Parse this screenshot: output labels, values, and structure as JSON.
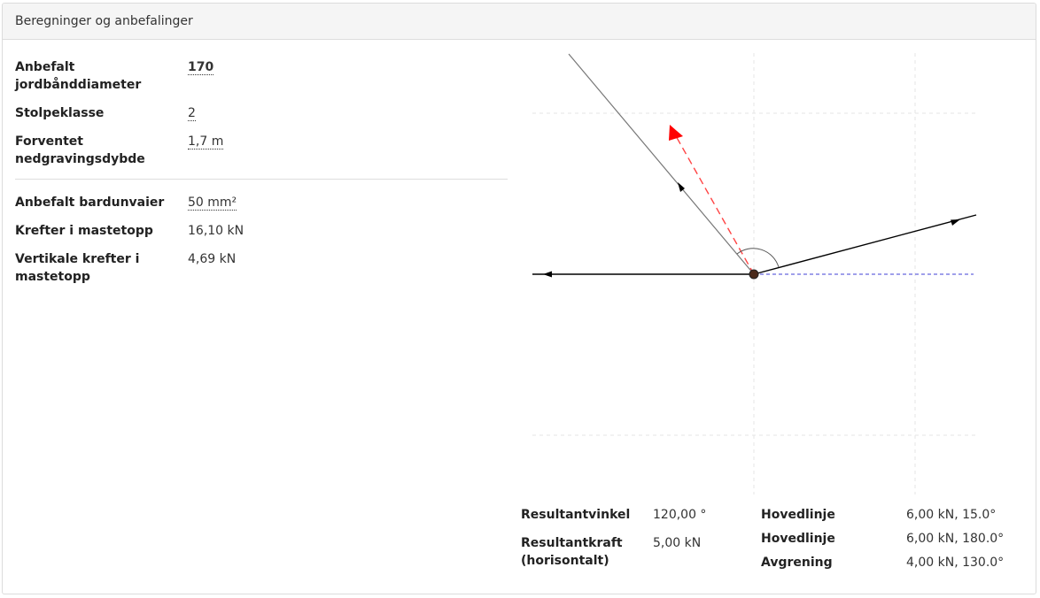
{
  "header": {
    "title": "Beregninger og anbefalinger"
  },
  "calc": {
    "jord_label": "Anbefalt jordbånddiameter",
    "jord_value": "170",
    "stolpe_label": "Stolpeklasse",
    "stolpe_value": "2",
    "dybde_label": "Forventet nedgravingsdybde",
    "dybde_value": "1,7 m",
    "bardun_label": "Anbefalt bardunvaier",
    "bardun_value": "50 mm²",
    "krefter_label": "Krefter i mastetopp",
    "krefter_value": "16,10 kN",
    "vert_label": "Vertikale krefter i mastetopp",
    "vert_value": "4,69 kN"
  },
  "result": {
    "vinkel_label": "Resultantvinkel",
    "vinkel_value": "120,00 °",
    "kraft_label": "Resultantkraft (horisontalt)",
    "kraft_value": "5,00 kN"
  },
  "lines": [
    {
      "name": "Hovedlinje",
      "value": "6,00 kN, 15.0°"
    },
    {
      "name": "Hovedlinje",
      "value": "6,00 kN, 180.0°"
    },
    {
      "name": "Avgrening",
      "value": "4,00 kN, 130.0°"
    }
  ],
  "colors": {
    "resultant": "#ff0000",
    "reference": "#6666dd",
    "line": "#000000",
    "branch": "#777777",
    "center": "#4a2a1a"
  }
}
